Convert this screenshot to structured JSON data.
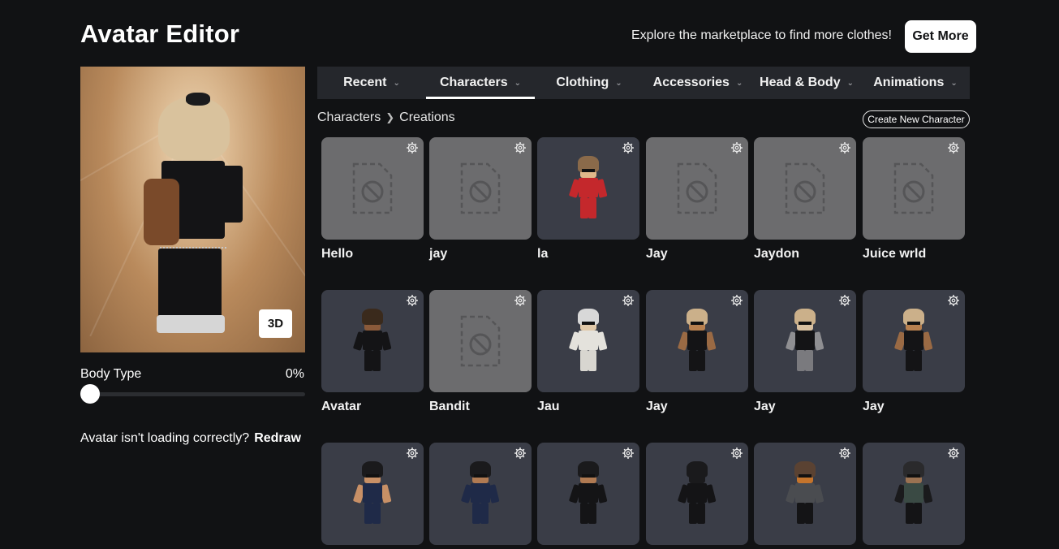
{
  "header": {
    "title": "Avatar Editor",
    "promo_text": "Explore the marketplace to find more clothes!",
    "get_more_label": "Get More"
  },
  "preview": {
    "view_toggle_label": "3D",
    "body_type_label": "Body Type",
    "body_type_value": "0%",
    "body_type_level": 0,
    "loading_issue_text": "Avatar isn't loading correctly?",
    "redraw_label": "Redraw"
  },
  "tabs": [
    {
      "label": "Recent",
      "active": false
    },
    {
      "label": "Characters",
      "active": true
    },
    {
      "label": "Clothing",
      "active": false
    },
    {
      "label": "Accessories",
      "active": false
    },
    {
      "label": "Head & Body",
      "active": false
    },
    {
      "label": "Animations",
      "active": false
    }
  ],
  "breadcrumb": {
    "parent": "Characters",
    "current": "Creations"
  },
  "create_button_label": "Create New Character",
  "characters": [
    {
      "name": "Hello",
      "thumb": "placeholder"
    },
    {
      "name": "jay",
      "thumb": "placeholder"
    },
    {
      "name": "la",
      "thumb": "red-outfit"
    },
    {
      "name": "Jay",
      "thumb": "placeholder"
    },
    {
      "name": "Jaydon",
      "thumb": "placeholder"
    },
    {
      "name": "Juice wrld",
      "thumb": "placeholder"
    },
    {
      "name": "Avatar",
      "thumb": "black-outfit-dark-hair"
    },
    {
      "name": "Bandit",
      "thumb": "placeholder"
    },
    {
      "name": "Jau",
      "thumb": "white-outfit"
    },
    {
      "name": "Jay",
      "thumb": "black-outfit-blonde"
    },
    {
      "name": "Jay",
      "thumb": "grey-outfit-blonde"
    },
    {
      "name": "Jay",
      "thumb": "black-outfit-blonde-shades"
    },
    {
      "name": "",
      "thumb": "fbi-outfit"
    },
    {
      "name": "",
      "thumb": "fbi-outfit-navy"
    },
    {
      "name": "",
      "thumb": "black-outfit-ears"
    },
    {
      "name": "",
      "thumb": "black-outfit-mask"
    },
    {
      "name": "",
      "thumb": "grey-outfit-orange-mask"
    },
    {
      "name": "",
      "thumb": "dark-outfit-goggles"
    }
  ],
  "icons": {
    "tab_chevron": "chevron-down-icon",
    "card_settings": "gear-icon",
    "placeholder": "unavailable-file-icon",
    "breadcrumb_separator": "chevron-right-icon"
  },
  "colors": {
    "background": "#111214",
    "tab_bar": "#25272c",
    "card": "#3a3d47",
    "placeholder_card": "#6c6c6e",
    "accent": "#ffffff"
  }
}
